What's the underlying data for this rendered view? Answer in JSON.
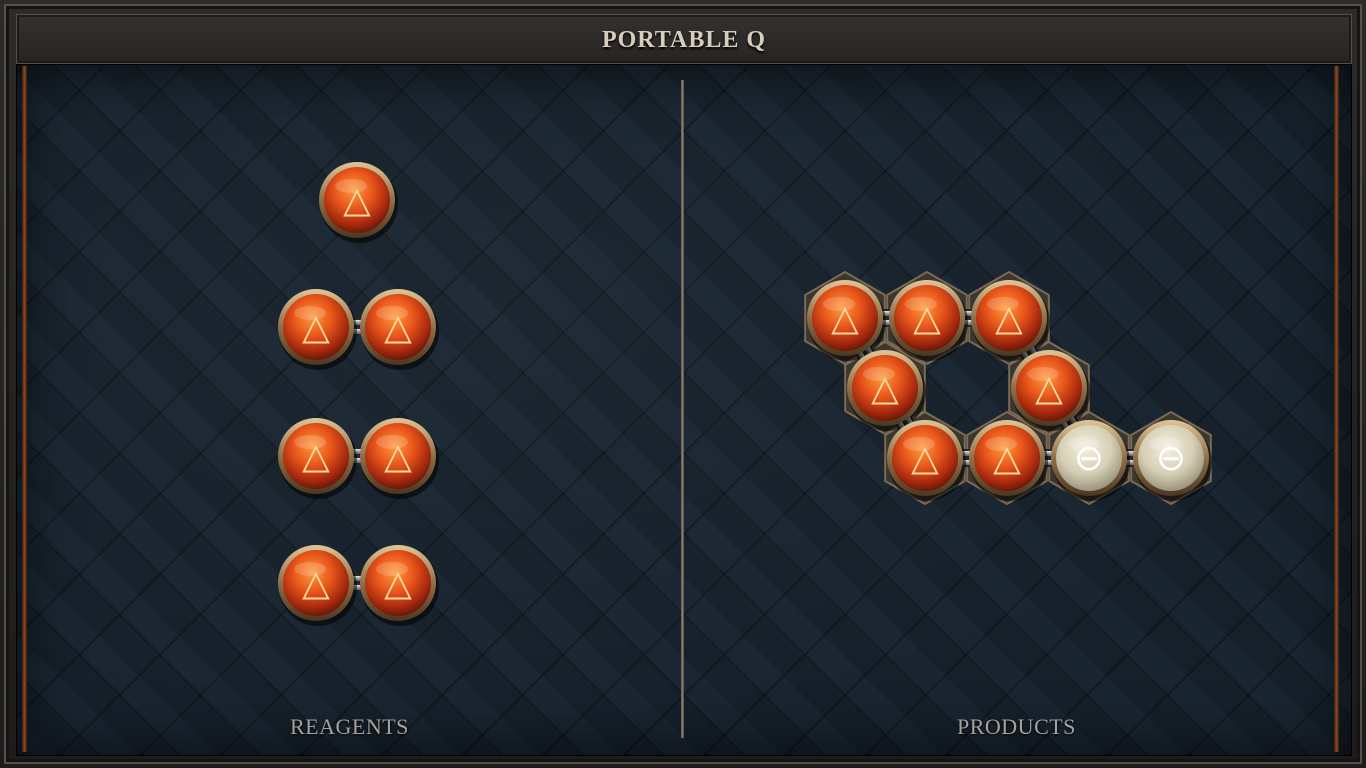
{
  "title": "PORTABLE Q",
  "labels": {
    "reagents": "REAGENTS",
    "products": "PRODUCTS"
  },
  "colors": {
    "fire_atom": "#e2551a",
    "salt_atom": "#d8d2bd",
    "bond_metal": "#b9bec2",
    "rim_brass": "#b8986a",
    "rail_copper": "#8a4a24"
  },
  "atom_types": {
    "fire": {
      "symbol": "△",
      "icon": "fire-triangle-icon"
    },
    "salt": {
      "symbol": "⊖",
      "icon": "salt-circle-icon"
    }
  },
  "reagents": [
    {
      "atoms": [
        {
          "type": "fire",
          "col": 0,
          "row": 0
        }
      ],
      "bonds": []
    },
    {
      "atoms": [
        {
          "type": "fire",
          "col": 0,
          "row": 0
        },
        {
          "type": "fire",
          "col": 1,
          "row": 0
        }
      ],
      "bonds": [
        [
          0,
          1
        ]
      ]
    },
    {
      "atoms": [
        {
          "type": "fire",
          "col": 0,
          "row": 0
        },
        {
          "type": "fire",
          "col": 1,
          "row": 0
        }
      ],
      "bonds": [
        [
          0,
          1
        ]
      ]
    },
    {
      "atoms": [
        {
          "type": "fire",
          "col": 0,
          "row": 0
        },
        {
          "type": "fire",
          "col": 1,
          "row": 0
        }
      ],
      "bonds": [
        [
          0,
          1
        ]
      ]
    }
  ],
  "products": [
    {
      "atoms": [
        {
          "type": "fire",
          "col": 0,
          "row": 0
        },
        {
          "type": "fire",
          "col": 1,
          "row": 0
        },
        {
          "type": "fire",
          "col": 2,
          "row": 0
        },
        {
          "type": "fire",
          "col": 0,
          "row": 1
        },
        {
          "type": "fire",
          "col": 2,
          "row": 1
        },
        {
          "type": "fire",
          "col": 0,
          "row": 2
        },
        {
          "type": "fire",
          "col": 1,
          "row": 2
        },
        {
          "type": "salt",
          "col": 2,
          "row": 2
        },
        {
          "type": "salt",
          "col": 3,
          "row": 2
        }
      ],
      "bonds": [
        [
          0,
          1
        ],
        [
          1,
          2
        ],
        [
          0,
          3
        ],
        [
          2,
          4
        ],
        [
          3,
          5
        ],
        [
          5,
          6
        ],
        [
          6,
          7
        ],
        [
          7,
          8
        ],
        [
          4,
          7
        ]
      ]
    }
  ]
}
